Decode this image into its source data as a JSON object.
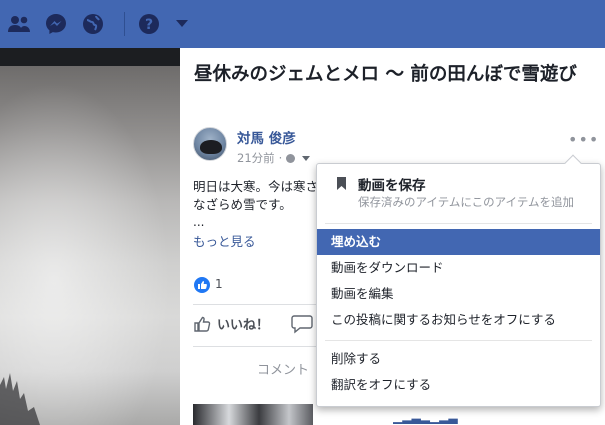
{
  "header": {
    "icons": [
      "friends-icon",
      "messenger-icon",
      "globe-icon",
      "help-icon",
      "chevron-down-icon"
    ]
  },
  "post": {
    "title": "昼休みのジェムとメロ 〜 前の田んぼで雪遊び",
    "author": "対馬 俊彦",
    "time": "21分前",
    "body_line1": "明日は大寒。今は寒さ",
    "body_line2": "なざらめ雪です。",
    "ellipsis": "...",
    "see_more": "もっと見る",
    "like_count": "1",
    "like_label": "いいね！",
    "comment_label": "コメント"
  },
  "menu": {
    "save_title": "動画を保存",
    "save_subtitle": "保存済みのアイテムにこのアイテムを追加",
    "items": [
      {
        "label": "埋め込む"
      },
      {
        "label": "動画をダウンロード"
      },
      {
        "label": "動画を編集"
      },
      {
        "label": "この投稿に関するお知らせをオフにする"
      },
      {
        "label": "削除する"
      },
      {
        "label": "翻訳をオフにする"
      }
    ]
  },
  "colors": {
    "header_bg": "#4267b2",
    "link": "#385898",
    "menu_highlight": "#4267b2"
  }
}
